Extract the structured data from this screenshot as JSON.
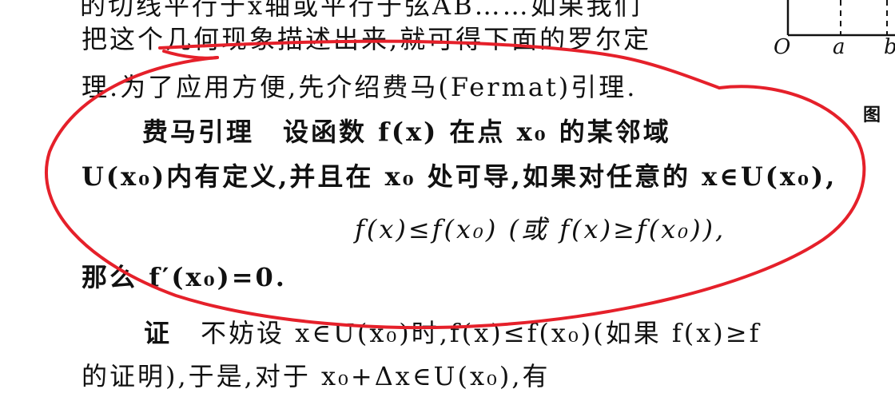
{
  "text": {
    "cut_top": "的切线平行于x轴或平行于弦AB……如果我们",
    "line1": "把这个几何现象描述出来,就可得下面的罗尔定",
    "line2": "理.为了应用方便,先介绍费马(Fermat)引理.",
    "lemma_title": "费马引理",
    "lemma_intro": "设函数 f(x) 在点 x₀ 的某邻域",
    "line4": "U(x₀)内有定义,并且在 x₀ 处可导,如果对任意的 x∈U(x₀),",
    "formula": "f(x)≤f(x₀)   (或 f(x)≥f(x₀)),",
    "conclusion": "那么 f′(x₀)=0.",
    "proof_label": "证",
    "proof_text": "不妨设 x∈U(x₀)时,f(x)≤f(x₀)(如果 f(x)≥f",
    "cut_bottom": "的证明),于是,对于 x₀+Δx∈U(x₀),有"
  },
  "figure": {
    "label_o": "O",
    "label_a": "a",
    "label_b": "b",
    "caption": "图"
  },
  "annotation_color": "#e5202a"
}
